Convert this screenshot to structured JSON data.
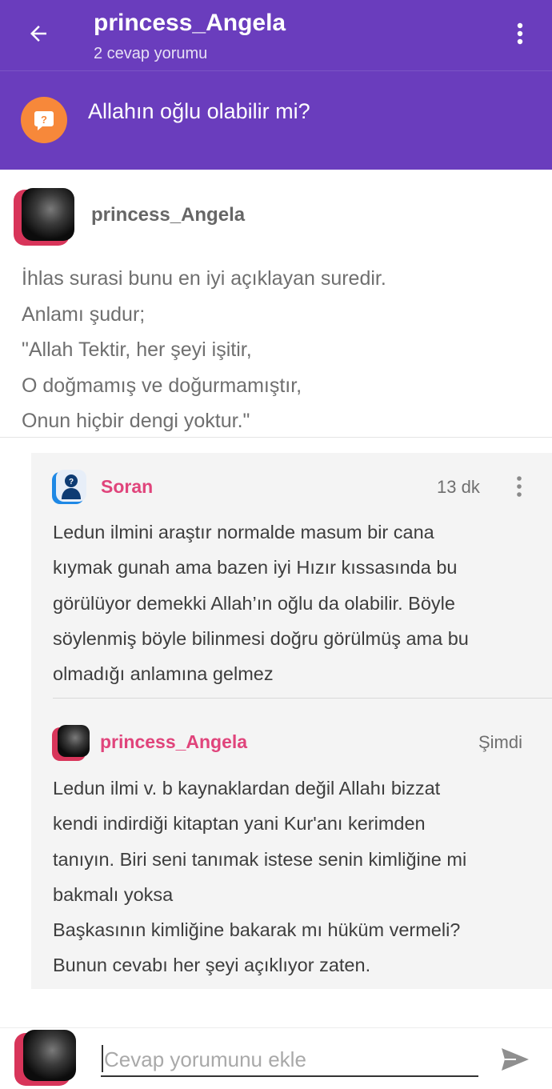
{
  "header": {
    "title": "princess_Angela",
    "subtitle": "2 cevap yorumu",
    "question": "Allahın oğlu olabilir mi?",
    "question_badge": "?",
    "color": "#6a3dbd",
    "badge_color": "#f7883a"
  },
  "answer": {
    "author": "princess_Angela",
    "lines": [
      "İhlas surasi bunu en iyi açıklayan suredir.",
      "Anlamı şudur;",
      "\"Allah Tektir, her şeyi işitir,",
      "O doğmamış ve doğurmamıştır,",
      "Onun hiçbir dengi yoktur.\""
    ]
  },
  "comments": [
    {
      "author": "Soran",
      "time": "13 dk",
      "lines": [
        "Ledun ilmini araştır normalde masum bir cana",
        "kıymak gunah ama bazen iyi Hızır kıssasında bu",
        "görülüyor demekki Allah’ın oğlu da olabilir. Böyle",
        "söylenmiş böyle bilinmesi doğru görülmüş ama bu",
        "olmadığı anlamına gelmez"
      ]
    },
    {
      "author": "princess_Angela",
      "time": "Şimdi",
      "lines": [
        "Ledun ilmi v. b kaynaklardan değil Allahı bizzat",
        "kendi indirdiği kitaptan yani Kur'anı kerimden",
        "tanıyın. Biri seni tanımak istese senin kimliğine mi",
        "bakmalı yoksa",
        "Başkasının kimliğine bakarak mı hüküm vermeli?",
        "Bunun cevabı her şeyi açıklıyor zaten."
      ]
    }
  ],
  "composer": {
    "placeholder": "Cevap yorumunu ekle"
  },
  "colors": {
    "author_pink": "#e0447b",
    "avatar_accent": "#d8355a",
    "asker_avatar": "#1e88e5"
  },
  "icons": [
    "back-arrow-icon",
    "more-vertical-icon",
    "question-icon",
    "user-silhouette-icon",
    "send-icon"
  ]
}
